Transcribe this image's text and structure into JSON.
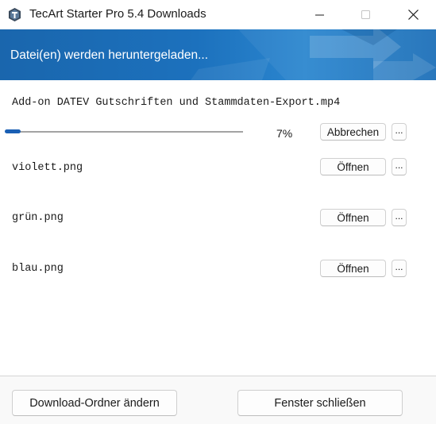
{
  "window": {
    "title": "TecArt Starter Pro 5.4 Downloads",
    "icon": "tecart-app-icon",
    "controls": {
      "minimize": "minimize-icon",
      "maximize": "maximize-icon",
      "close": "close-icon"
    }
  },
  "banner": {
    "text": "Datei(en) werden heruntergeladen..."
  },
  "active_download": {
    "filename": "Add-on DATEV Gutschriften und Stammdaten-Export.mp4",
    "progress": 0.07,
    "percent_label": "7%",
    "cancel_label": "Abbrechen",
    "more_label": "..."
  },
  "completed_downloads": [
    {
      "filename": "violett.png",
      "open_label": "Öffnen",
      "more_label": "..."
    },
    {
      "filename": "grün.png",
      "open_label": "Öffnen",
      "more_label": "..."
    },
    {
      "filename": "blau.png",
      "open_label": "Öffnen",
      "more_label": "..."
    }
  ],
  "footer": {
    "change_folder_label": "Download-Ordner ändern",
    "close_window_label": "Fenster schließen"
  },
  "colors": {
    "banner": "#1c71bd",
    "progress": "#1a5fb4"
  }
}
